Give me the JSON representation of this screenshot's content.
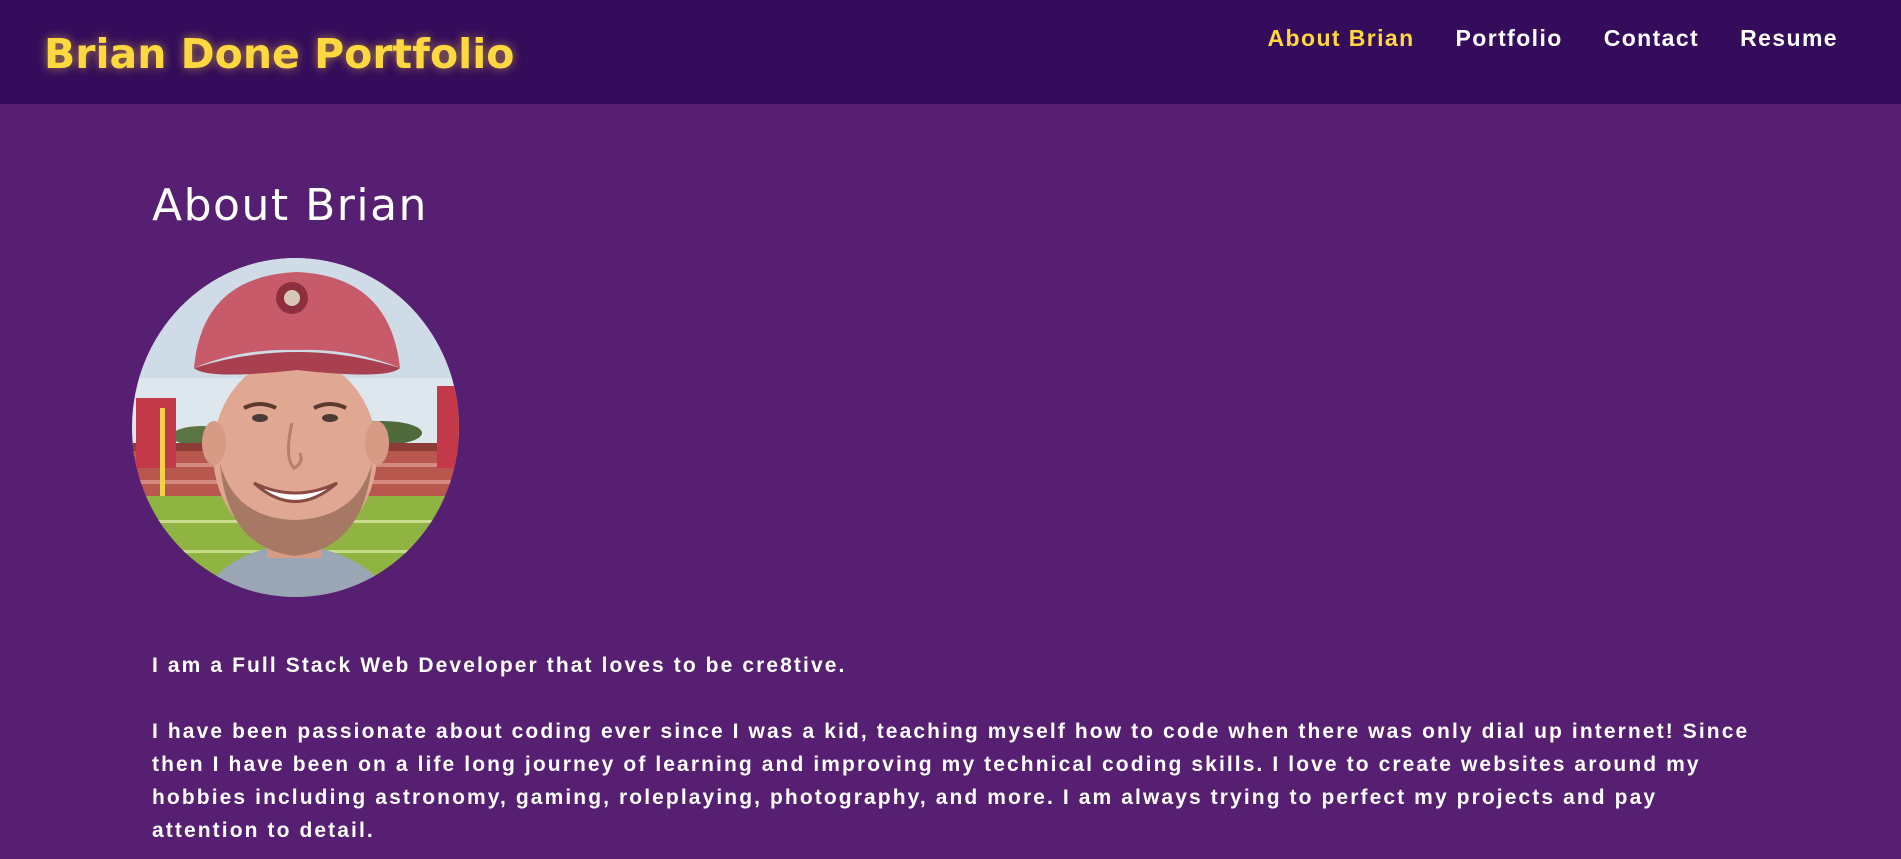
{
  "header": {
    "brand": "Brian Done Portfolio",
    "nav": [
      {
        "label": "About Brian",
        "active": true
      },
      {
        "label": "Portfolio",
        "active": false
      },
      {
        "label": "Contact",
        "active": false
      },
      {
        "label": "Resume",
        "active": false
      }
    ]
  },
  "main": {
    "title": "About Brian",
    "avatar_icon": "profile-photo",
    "paragraphs": [
      "I am a Full Stack Web Developer that loves to be cre8tive.",
      "I have been passionate about coding ever since I was a kid, teaching myself how to code when there was only dial up internet! Since then I have been on a life long journey of learning and improving my technical coding skills. I love to create websites around my hobbies including astronomy, gaming, roleplaying, photography, and more. I am always trying to perfect my projects and pay attention to detail."
    ]
  },
  "colors": {
    "page_background": "#561f72",
    "header_background": "#340c5b",
    "accent": "#ffd83f",
    "text": "#ffffff"
  }
}
